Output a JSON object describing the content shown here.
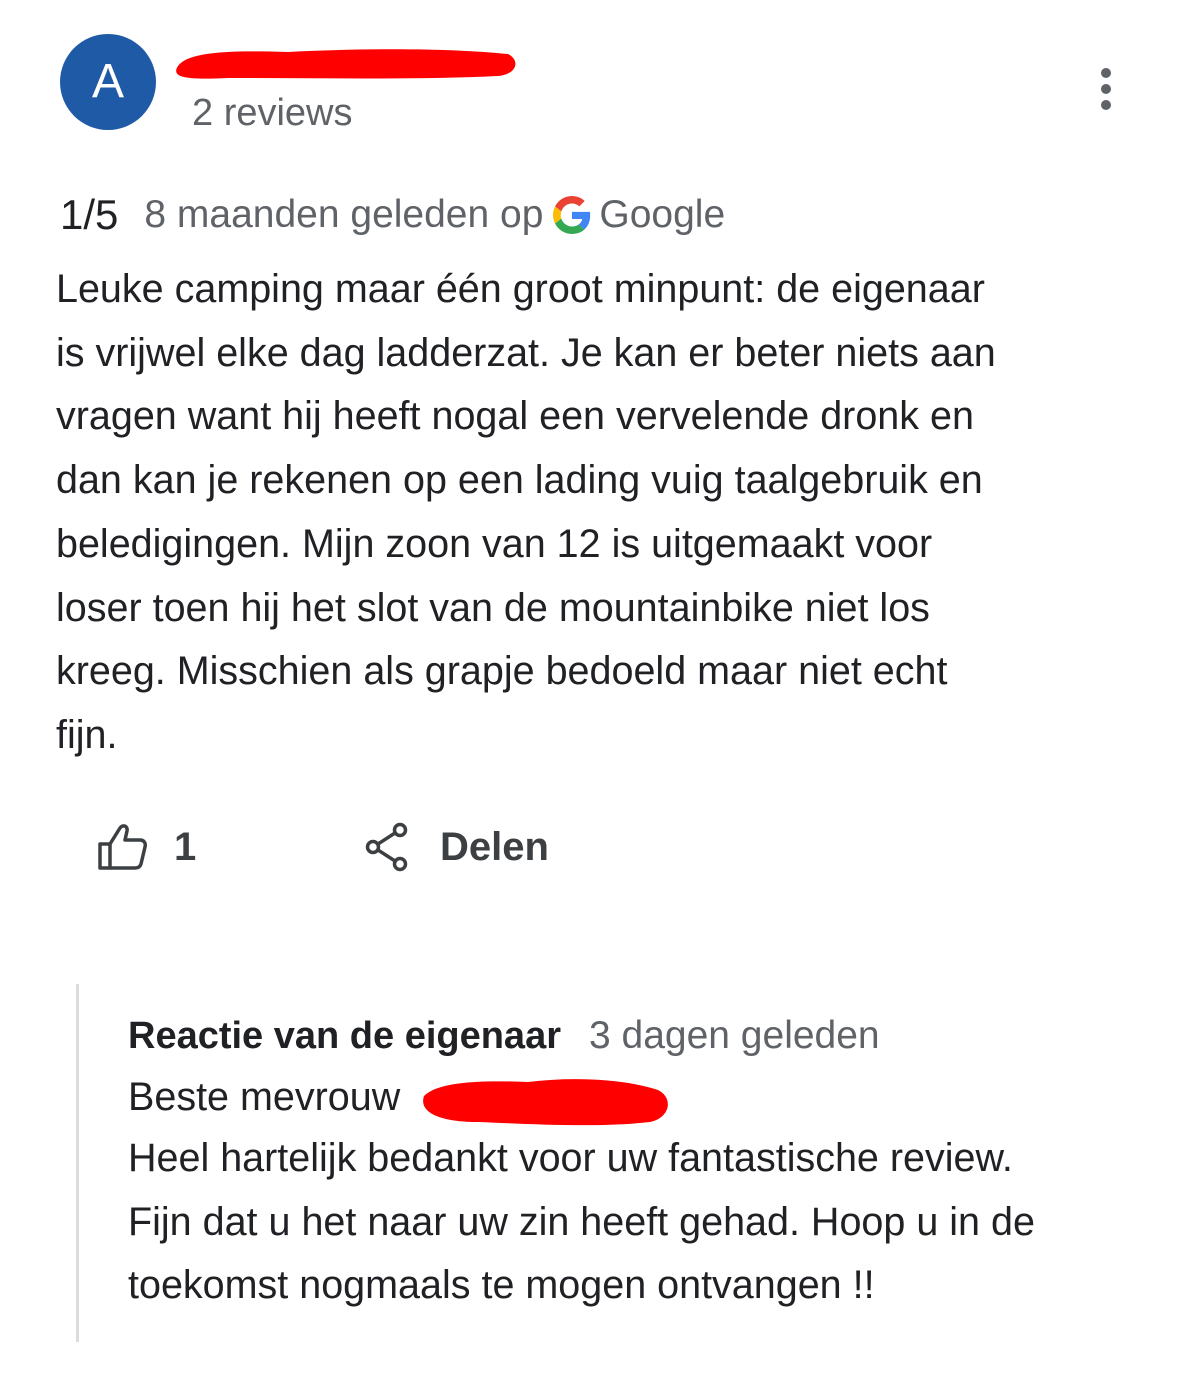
{
  "reviewer": {
    "avatar_letter": "A",
    "avatar_color": "#1f5aa6",
    "review_count": "2 reviews",
    "name_redaction_color": "#ff0000"
  },
  "menu": {
    "icon": "more-vert-icon"
  },
  "review": {
    "rating": "1/5",
    "time_ago": "8 maanden geleden op",
    "source_icon": "google-g-icon",
    "source": "Google",
    "text": "Leuke camping maar één groot minpunt: de eigenaar\nis vrijwel elke dag ladderzat. Je kan er beter niets aan\nvragen want hij heeft nogal een vervelende dronk en\ndan kan je rekenen op een lading vuig taalgebruik en\nbeledigingen. Mijn zoon van 12 is uitgemaakt voor\nloser toen hij het slot van de mountainbike niet los\nkreeg. Misschien als grapje bedoeld maar niet echt\nfijn."
  },
  "actions": {
    "like_icon": "thumbs-up-icon",
    "like_count": "1",
    "share_icon": "share-icon",
    "share_label": "Delen"
  },
  "owner_reply": {
    "label": "Reactie van de eigenaar",
    "time_ago": "3 dagen geleden",
    "greeting": "Beste mevrouw",
    "body": "Heel hartelijk bedankt voor uw fantastische review.\nFijn dat u het naar uw zin heeft gehad. Hoop u in de\ntoekomst nogmaals te mogen ontvangen !!"
  }
}
